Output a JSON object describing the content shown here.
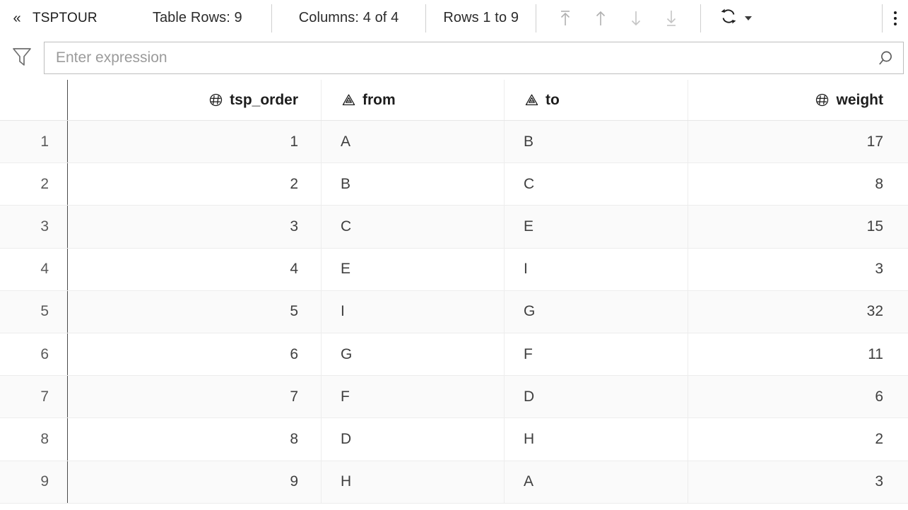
{
  "toolbar": {
    "collapse_label": "«",
    "table_name": "TSPTOUR",
    "table_rows": "Table Rows: 9",
    "columns": "Columns: 4 of 4",
    "row_range": "Rows 1 to 9",
    "nav": [
      {
        "name": "first-rows-button",
        "label": "Go to first rows"
      },
      {
        "name": "previous-rows-button",
        "label": "Go to previous rows"
      },
      {
        "name": "next-rows-button",
        "label": "Go to next rows"
      },
      {
        "name": "last-rows-button",
        "label": "Go to last rows"
      }
    ],
    "refresh_label": "Refresh",
    "refresh_dropdown_label": "Refresh options",
    "more_label": "More options"
  },
  "filter": {
    "funnel_label": "Filter",
    "expression_value": "",
    "placeholder": "Enter expression",
    "search_label": "Search"
  },
  "grid": {
    "row_header_label": "",
    "columns": [
      {
        "key": "tsp_order",
        "label": "tsp_order",
        "type": "number",
        "icon": "number-column-icon",
        "align": "right"
      },
      {
        "key": "from",
        "label": "from",
        "type": "string",
        "icon": "string-column-icon",
        "align": "left"
      },
      {
        "key": "to",
        "label": "to",
        "type": "string",
        "icon": "string-column-icon",
        "align": "left"
      },
      {
        "key": "weight",
        "label": "weight",
        "type": "number",
        "icon": "number-column-icon",
        "align": "right"
      }
    ],
    "rows": [
      {
        "n": "1",
        "tsp_order": "1",
        "from": "A",
        "to": "B",
        "weight": "17"
      },
      {
        "n": "2",
        "tsp_order": "2",
        "from": "B",
        "to": "C",
        "weight": "8"
      },
      {
        "n": "3",
        "tsp_order": "3",
        "from": "C",
        "to": "E",
        "weight": "15"
      },
      {
        "n": "4",
        "tsp_order": "4",
        "from": "E",
        "to": "I",
        "weight": "3"
      },
      {
        "n": "5",
        "tsp_order": "5",
        "from": "I",
        "to": "G",
        "weight": "32"
      },
      {
        "n": "6",
        "tsp_order": "6",
        "from": "G",
        "to": "F",
        "weight": "11"
      },
      {
        "n": "7",
        "tsp_order": "7",
        "from": "F",
        "to": "D",
        "weight": "6"
      },
      {
        "n": "8",
        "tsp_order": "8",
        "from": "D",
        "to": "H",
        "weight": "2"
      },
      {
        "n": "9",
        "tsp_order": "9",
        "from": "H",
        "to": "A",
        "weight": "3"
      }
    ]
  },
  "colors": {
    "text": "#3c3c3c",
    "header_text": "#1d1d1d",
    "row_alt": "#fafafa",
    "grid_line": "#ededed",
    "gutter_divider": "#4a4a4a",
    "placeholder": "#9b9b9b",
    "icon": "#9a9a9a"
  }
}
